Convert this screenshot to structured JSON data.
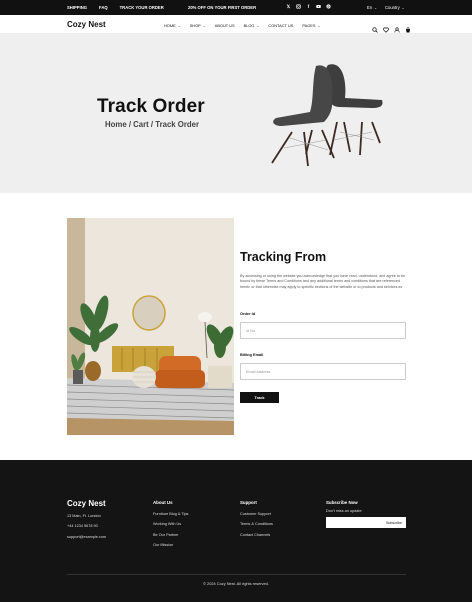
{
  "topbar": {
    "links": [
      "SHIPPING",
      "FAQ",
      "TRACK YOUR ORDER"
    ],
    "promo": "20% OFF ON YOUR FIRST ORDER",
    "language": "En",
    "country": "Country"
  },
  "header": {
    "logo": "Cozy Nest",
    "nav": [
      {
        "label": "HOME",
        "dropdown": true
      },
      {
        "label": "SHOP",
        "dropdown": true
      },
      {
        "label": "ABOUT US",
        "dropdown": false
      },
      {
        "label": "BLOG",
        "dropdown": true
      },
      {
        "label": "CONTACT US",
        "dropdown": false
      },
      {
        "label": "PAGES",
        "dropdown": true
      }
    ]
  },
  "hero": {
    "title": "Track Order",
    "breadcrumb": "Home / Cart / Track Order"
  },
  "tracking": {
    "title": "Tracking From",
    "description": "By accessing or using the website you acknowledge that you have read, understood, and agree to be bound by these Terms and Conditions and any additional terms and conditions that are referenced herein or that otherwise may apply to specific sections of the website or to products and services av",
    "order_label": "Order Id",
    "order_placeholder": "Id No.",
    "email_label": "Billing Email",
    "email_placeholder": "Email Address",
    "button": "Track"
  },
  "footer": {
    "logo": "Cozy Nest",
    "contact": [
      "13 Main, Ft. London",
      "+44 1234 5678 90",
      "support@example.com"
    ],
    "about_title": "About Us",
    "about_links": [
      "Furniture Blog & Tips",
      "Working With Us",
      "Be Our Partner",
      "Our Mission"
    ],
    "support_title": "Support",
    "support_links": [
      "Customer Support",
      "Terms & Conditions",
      "Contact Channels"
    ],
    "subscribe_title": "Subscribe Now",
    "subscribe_note": "Don't miss an update",
    "subscribe_button": "Subscribe",
    "copyright": "© 2024 Cozy Nest. All rights reserved."
  }
}
